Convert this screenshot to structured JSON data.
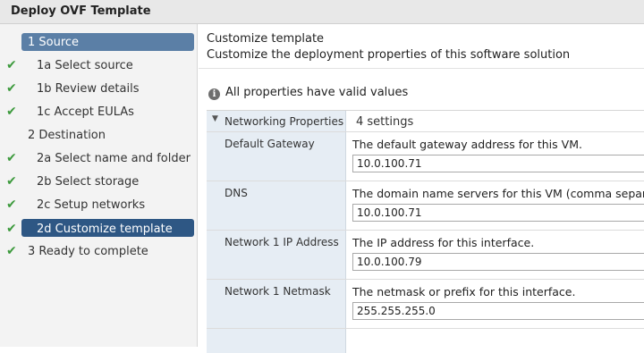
{
  "window": {
    "title": "Deploy OVF Template"
  },
  "sidebar": {
    "steps": [
      {
        "label": "1  Source",
        "checked": false,
        "state": "active"
      },
      {
        "label": "1a  Select source",
        "checked": true,
        "state": ""
      },
      {
        "label": "1b  Review details",
        "checked": true,
        "state": ""
      },
      {
        "label": "1c  Accept EULAs",
        "checked": true,
        "state": ""
      },
      {
        "label": "2  Destination",
        "checked": false,
        "state": ""
      },
      {
        "label": "2a  Select name and folder",
        "checked": true,
        "state": ""
      },
      {
        "label": "2b  Select storage",
        "checked": true,
        "state": ""
      },
      {
        "label": "2c  Setup networks",
        "checked": true,
        "state": ""
      },
      {
        "label": "2d  Customize template",
        "checked": true,
        "state": "selected"
      },
      {
        "label": "3  Ready to complete",
        "checked": true,
        "state": ""
      }
    ],
    "check_glyph": "✔"
  },
  "main": {
    "heading": "Customize template",
    "subheading": "Customize the deployment properties of this software solution",
    "validity": {
      "icon": "info-icon",
      "text": "All properties have valid values"
    },
    "group": {
      "label": "Networking Properties",
      "count": "4 settings",
      "expanded": true
    },
    "properties": [
      {
        "name": "Default Gateway",
        "description": "The default gateway address for this VM.",
        "value": "10.0.100.71"
      },
      {
        "name": "DNS",
        "description": "The domain name servers for this VM (comma separated",
        "value": "10.0.100.71"
      },
      {
        "name": "Network 1 IP Address",
        "description": "The IP address for this interface.",
        "value": "10.0.100.79"
      },
      {
        "name": "Network 1 Netmask",
        "description": "The netmask or prefix for this interface.",
        "value": "255.255.255.0"
      }
    ]
  },
  "colors": {
    "accent_active": "#5b7fa6",
    "accent_selected": "#2e5784",
    "check": "#3d9a3d",
    "key_column": "#e6edf4"
  }
}
